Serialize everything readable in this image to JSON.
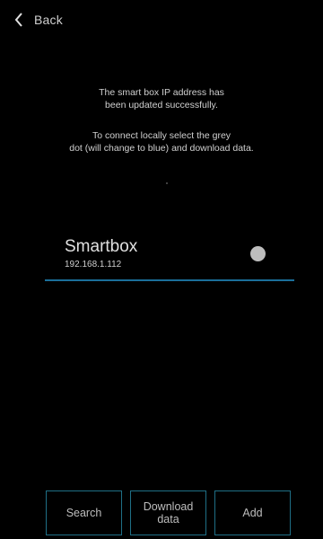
{
  "header": {
    "back_label": "Back"
  },
  "message": {
    "line1": "The smart box IP address has\nbeen updated successfully.",
    "line2": "To connect locally select the grey\ndot (will change to blue) and download data."
  },
  "device": {
    "name": "Smartbox",
    "ip": "192.168.1.112"
  },
  "status": {
    "dot_color": "#bdbdbd",
    "connected_color": "#1b6f9a"
  },
  "buttons": {
    "search": "Search",
    "download": "Download\ndata",
    "add": "Add"
  }
}
